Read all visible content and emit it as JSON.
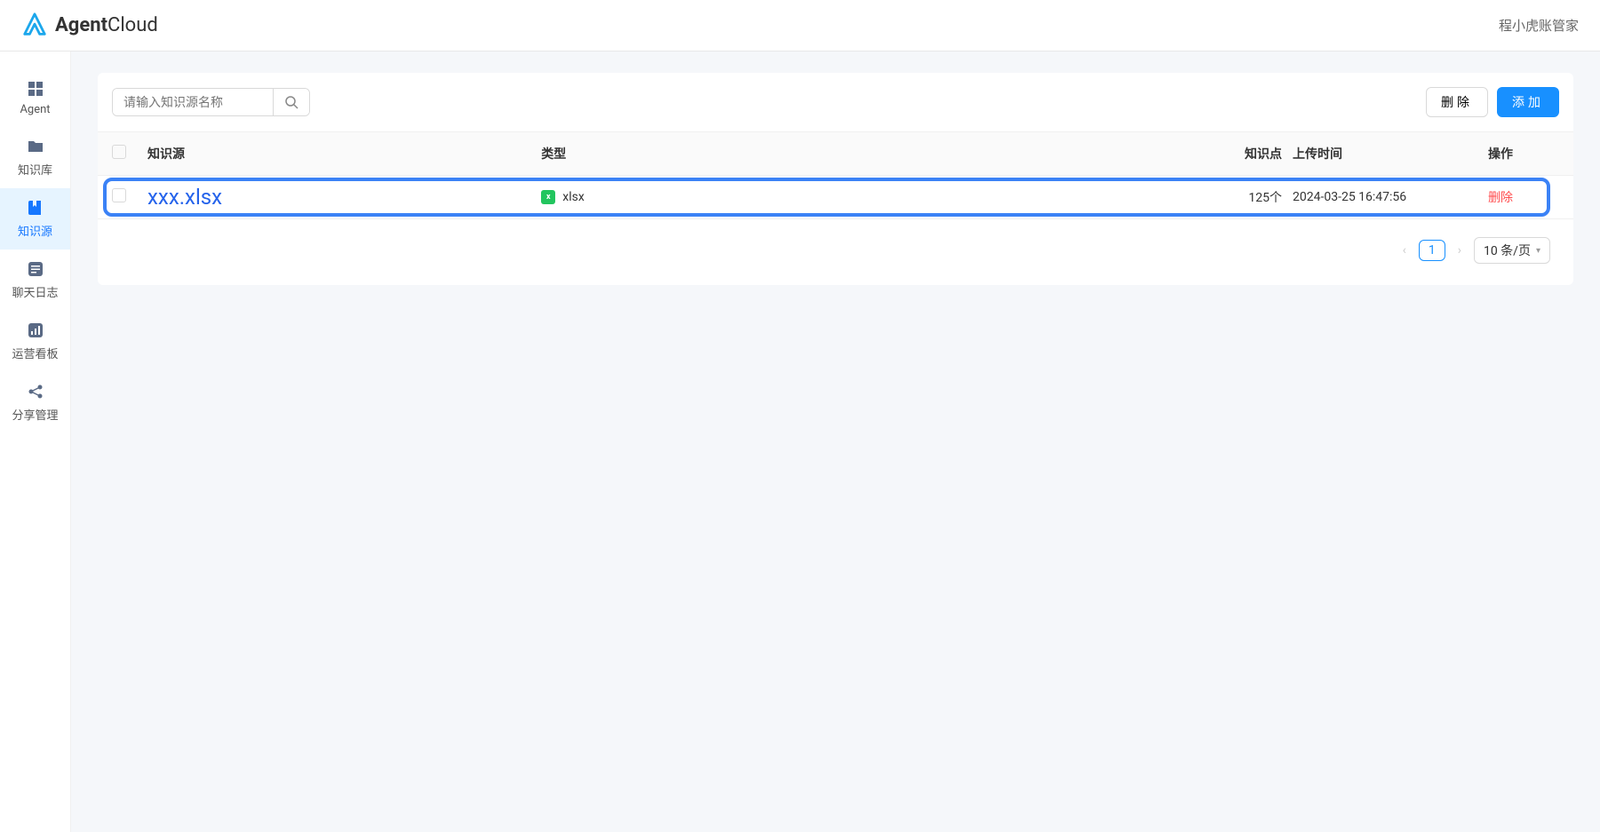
{
  "header": {
    "logo_bold": "Agent",
    "logo_light": "Cloud",
    "user_label": "程小虎账管家"
  },
  "sidebar": {
    "items": [
      {
        "label": "Agent",
        "icon": "grid"
      },
      {
        "label": "知识库",
        "icon": "folder"
      },
      {
        "label": "知识源",
        "icon": "book"
      },
      {
        "label": "聊天日志",
        "icon": "chat"
      },
      {
        "label": "运营看板",
        "icon": "chart"
      },
      {
        "label": "分享管理",
        "icon": "share"
      }
    ],
    "active_index": 2
  },
  "toolbar": {
    "search_placeholder": "请输入知识源名称",
    "delete_label": "删除",
    "add_label": "添加"
  },
  "table": {
    "columns": {
      "name": "知识源",
      "type": "类型",
      "points": "知识点",
      "upload_time": "上传时间",
      "action": "操作"
    },
    "rows": [
      {
        "name": "xxx.xlsx",
        "type": "xlsx",
        "points": "125个",
        "upload_time": "2024-03-25 16:47:56",
        "action": "删除",
        "highlighted": true
      }
    ]
  },
  "pagination": {
    "current": "1",
    "page_size_label": "10 条/页"
  }
}
